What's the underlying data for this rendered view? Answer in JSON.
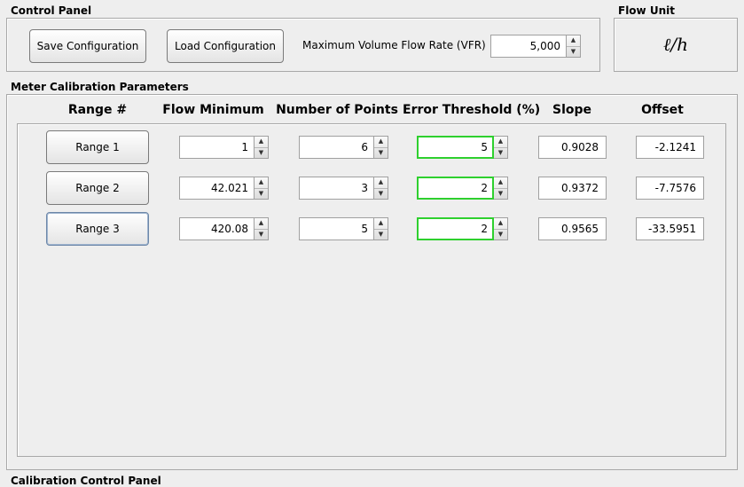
{
  "control_panel": {
    "title": "Control Panel",
    "save_label": "Save Configuration",
    "load_label": "Load Configuration",
    "vfr_label": "Maximum Volume Flow Rate (VFR)",
    "vfr_value": "5,000"
  },
  "flow_unit": {
    "title": "Flow Unit",
    "value": "ℓ/h"
  },
  "calibration": {
    "title": "Meter Calibration Parameters",
    "headers": {
      "range": "Range #",
      "flow_min": "Flow Minimum",
      "num_points": "Number of Points",
      "error_threshold": "Error Threshold (%)",
      "slope": "Slope",
      "offset": "Offset"
    },
    "rows": [
      {
        "label": "Range 1",
        "flow_min": "1",
        "num_points": "6",
        "error_threshold": "5",
        "slope": "0.9028",
        "offset": "-2.1241"
      },
      {
        "label": "Range 2",
        "flow_min": "42.021",
        "num_points": "3",
        "error_threshold": "2",
        "slope": "0.9372",
        "offset": "-7.7576"
      },
      {
        "label": "Range 3",
        "flow_min": "420.08",
        "num_points": "5",
        "error_threshold": "2",
        "slope": "0.9565",
        "offset": "-33.5951"
      }
    ],
    "highlight_color": "#2ed02e"
  },
  "bottom_panel": {
    "title": "Calibration Control Panel"
  },
  "icons": {
    "up": "spin-up-arrow-icon",
    "down": "spin-down-arrow-icon"
  }
}
